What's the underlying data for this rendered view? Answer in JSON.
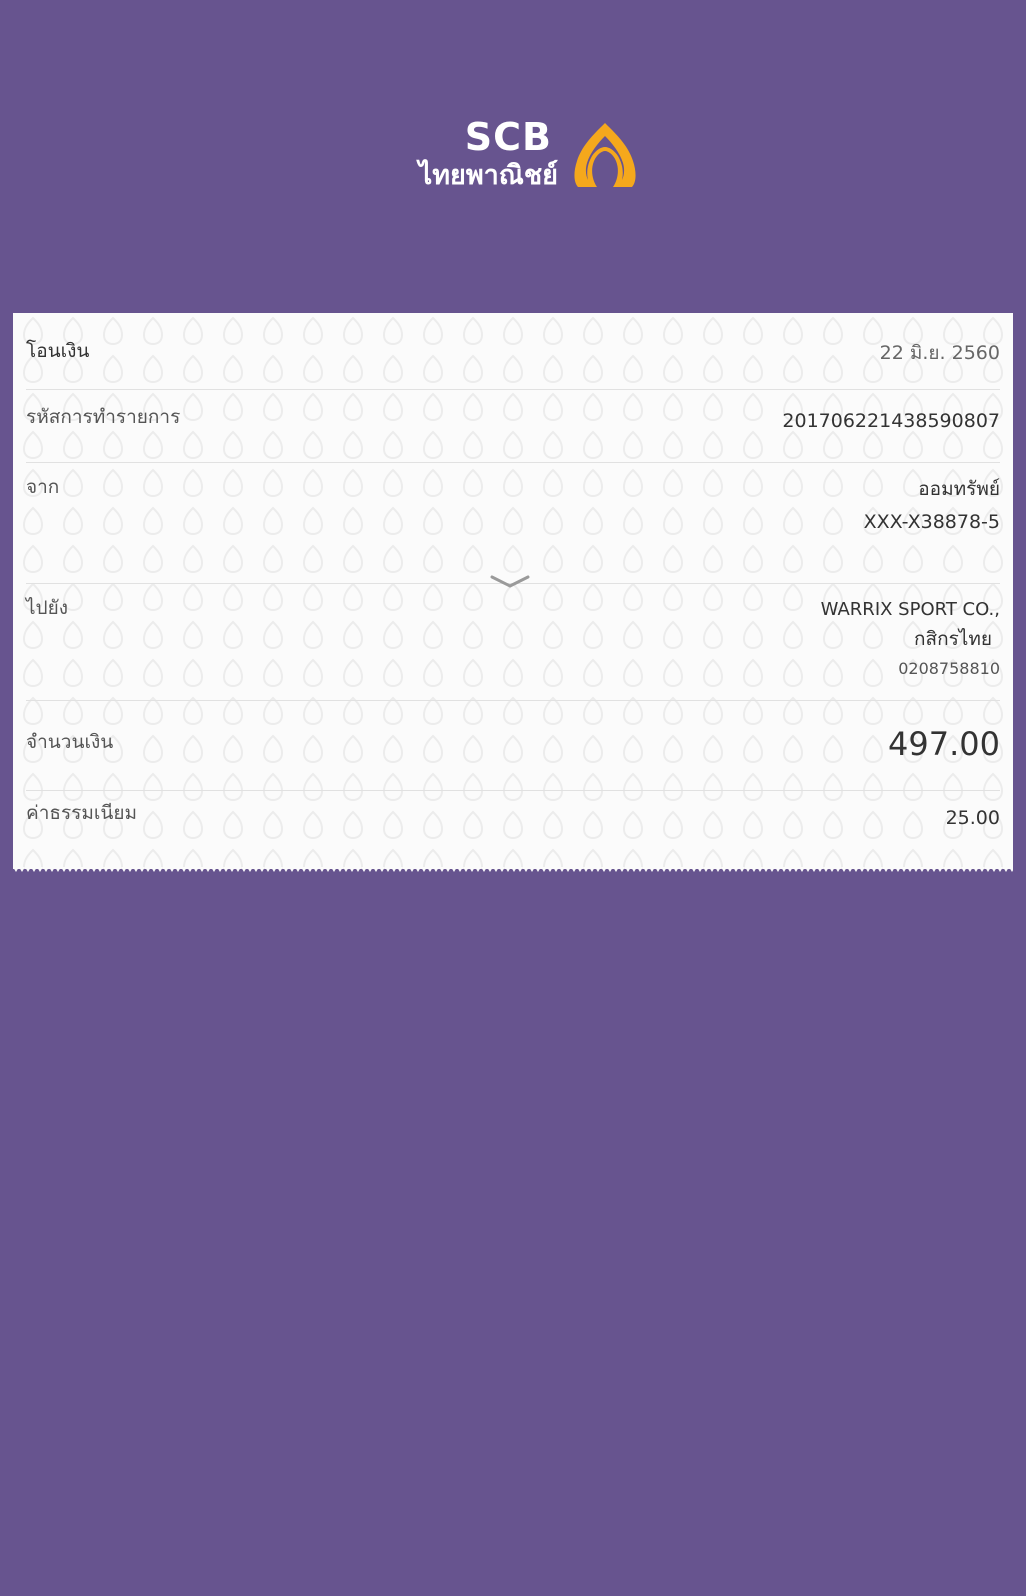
{
  "brand": {
    "name_en": "SCB",
    "name_th": "ไทยพาณิชย์",
    "accent_color": "#f5a81c",
    "background_color": "#67548f",
    "logo_icon": "scb-bai-sema-icon"
  },
  "receipt": {
    "title": "โอนเงิน",
    "date": "22 มิ.ย. 2560",
    "reference_label": "รหัสการทำรายการ",
    "reference_value": "201706221438590807",
    "from_label": "จาก",
    "from_account_name": "ออมทรัพย์",
    "from_account_number": "XXX-X38878-5",
    "expand_icon": "chevron-down-icon",
    "to_label": "ไปยัง",
    "to_name": "WARRIX SPORT CO.,",
    "to_bank": "กสิกรไทย",
    "to_account_number": "0208758810",
    "amount_label": "จำนวนเงิน",
    "amount_value": "497.00",
    "fee_label": "ค่าธรรมเนียม",
    "fee_value": "25.00"
  }
}
